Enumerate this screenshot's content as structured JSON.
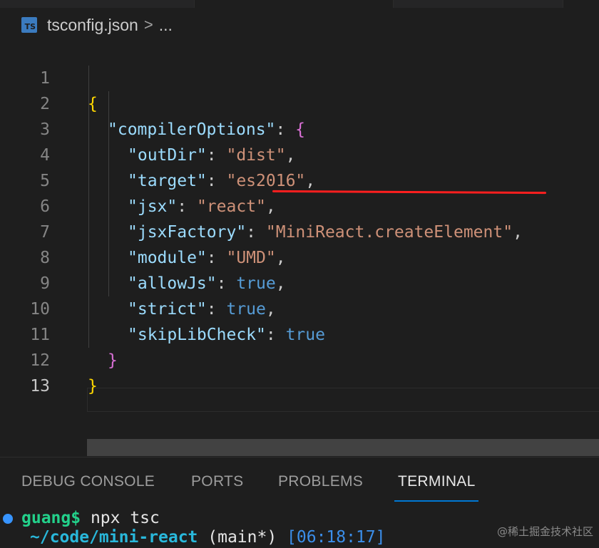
{
  "breadcrumb": {
    "file_icon": "TS",
    "file": "tsconfig.json",
    "separator": ">",
    "more": "..."
  },
  "editor": {
    "line_numbers": [
      "1",
      "2",
      "3",
      "4",
      "5",
      "6",
      "7",
      "8",
      "9",
      "10",
      "11",
      "12",
      "13"
    ],
    "active_line": "13",
    "highlight": "underline under \"MiniReact.createElement\"",
    "lines": [
      {
        "open_brace": "{"
      },
      {
        "key": "\"compilerOptions\"",
        "sep": ": ",
        "brace": "{"
      },
      {
        "key": "\"outDir\"",
        "sep": ": ",
        "value": "\"dist\"",
        "end": ","
      },
      {
        "key": "\"target\"",
        "sep": ": ",
        "value": "\"es2016\"",
        "end": ","
      },
      {
        "key": "\"jsx\"",
        "sep": ": ",
        "value": "\"react\"",
        "end": ","
      },
      {
        "key": "\"jsxFactory\"",
        "sep": ": ",
        "value": "\"MiniReact.createElement\"",
        "end": ","
      },
      {
        "key": "\"module\"",
        "sep": ": ",
        "value": "\"UMD\"",
        "end": ","
      },
      {
        "key": "\"allowJs\"",
        "sep": ": ",
        "value": "true",
        "end": ","
      },
      {
        "key": "\"strict\"",
        "sep": ": ",
        "value": "true",
        "end": ","
      },
      {
        "key": "\"skipLibCheck\"",
        "sep": ": ",
        "value": "true",
        "end": ""
      },
      {
        "brace": "}"
      },
      {
        "brace": "}"
      },
      {}
    ]
  },
  "panel": {
    "tabs": [
      "DEBUG CONSOLE",
      "PORTS",
      "PROBLEMS",
      "TERMINAL"
    ],
    "active_tab": "TERMINAL"
  },
  "terminal": {
    "user": "guang$",
    "command": " npx tsc",
    "path": "~/code/mini-react",
    "branch": " (main*) ",
    "time": "[06:18:17]"
  },
  "watermark": "@稀土掘金技术社区",
  "colors": {
    "background": "#1e1e1e",
    "key": "#9cdcfe",
    "string": "#ce9178",
    "boolean": "#569cd6",
    "brace_level1": "#ffd700",
    "brace_level2": "#da70d6",
    "underline": "#ff1f1f",
    "tab_active_underline": "#0078d4"
  }
}
